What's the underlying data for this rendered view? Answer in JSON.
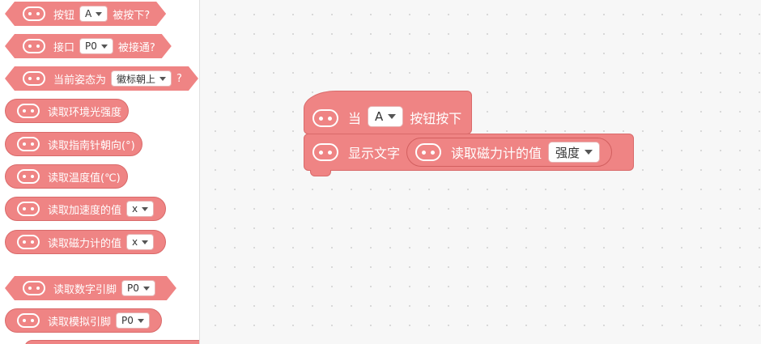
{
  "flyout": {
    "blocks": [
      {
        "pre": "按钮",
        "dropdown": "A",
        "post": "被按下?"
      },
      {
        "pre": "接口",
        "dropdown": "P0",
        "post": "被接通?"
      },
      {
        "pre": "当前姿态为",
        "dropdown": "徽标朝上",
        "post": "?"
      },
      {
        "pre": "读取环境光强度"
      },
      {
        "pre": "读取指南针朝向(°)"
      },
      {
        "pre": "读取温度值(℃)"
      },
      {
        "pre": "读取加速度的值",
        "dropdown": "x"
      },
      {
        "pre": "读取磁力计的值",
        "dropdown": "x"
      },
      {
        "pre": "读取数字引脚",
        "dropdown": "P0"
      },
      {
        "pre": "读取模拟引脚",
        "dropdown": "P0"
      }
    ]
  },
  "workspace": {
    "hat": {
      "pre": "当",
      "dropdown": "A",
      "post": "按钮按下"
    },
    "statement": {
      "label": "显示文字",
      "reporter_label": "读取磁力计的值",
      "reporter_dropdown": "强度"
    }
  },
  "colors": {
    "block": "#ef8484",
    "block_border": "#d96a6a"
  }
}
